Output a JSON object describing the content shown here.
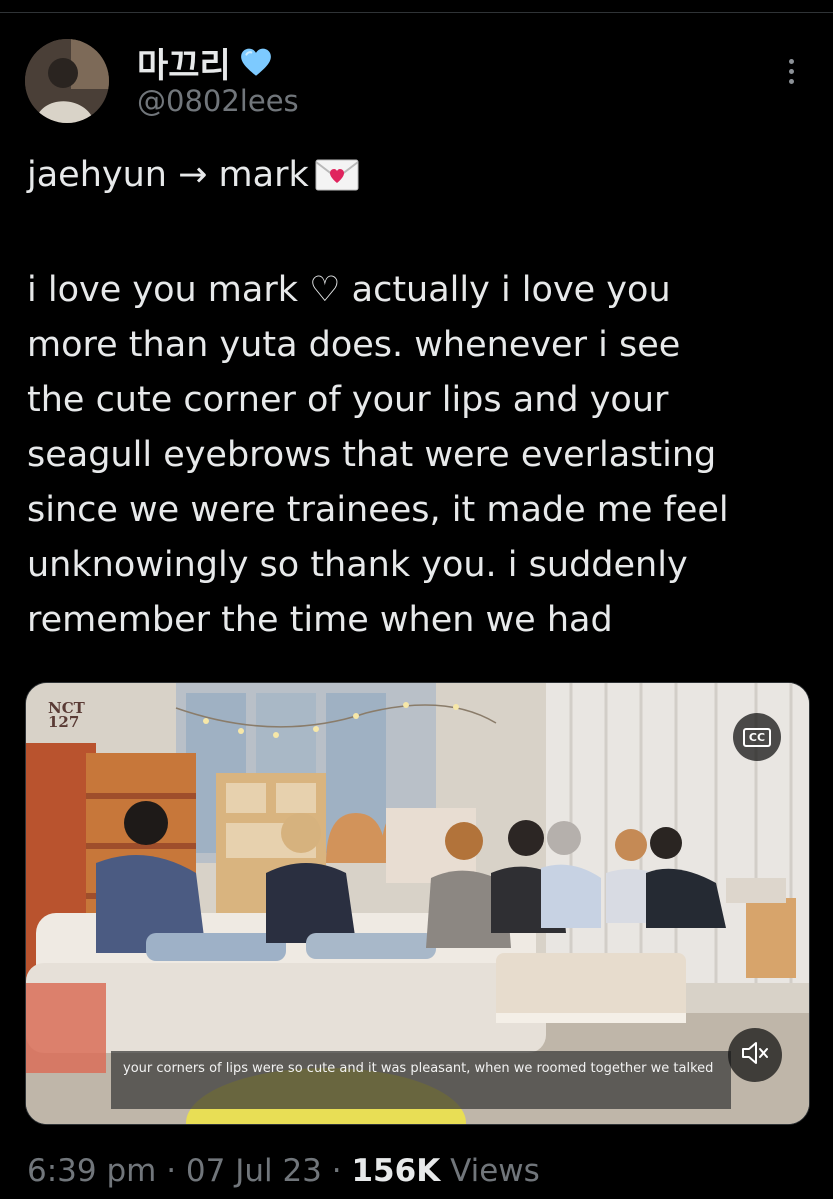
{
  "author": {
    "display_name": "마끄리",
    "handle": "@0802lees",
    "badge_icon": "blue-heart-icon"
  },
  "tweet": {
    "line1": "jaehyun → mark",
    "line1_icon": "love-letter-icon",
    "body": [
      "i love you mark ♡ actually i love you",
      "more than yuta does. whenever i see",
      "the cute corner of your lips and your",
      "seagull eyebrows that were everlasting",
      "since we were trainees, it made me feel",
      "unknowingly so thank you. i suddenly",
      "remember the time when we had"
    ]
  },
  "media": {
    "logo_text": "NCT 127",
    "cc_label": "CC",
    "subtitle": "your corners of lips were so cute and it was pleasant, when we roomed together we talked",
    "mute_icon": "speaker-muted-icon"
  },
  "meta": {
    "time": "6:39 pm",
    "sep1": " · ",
    "date": "07 Jul 23",
    "sep2": " · ",
    "views_count": "156K",
    "views_label": " Views"
  },
  "colors": {
    "background": "#000000",
    "text": "#e7e9ea",
    "secondary": "#71767b",
    "heart": "#7dcaff"
  }
}
